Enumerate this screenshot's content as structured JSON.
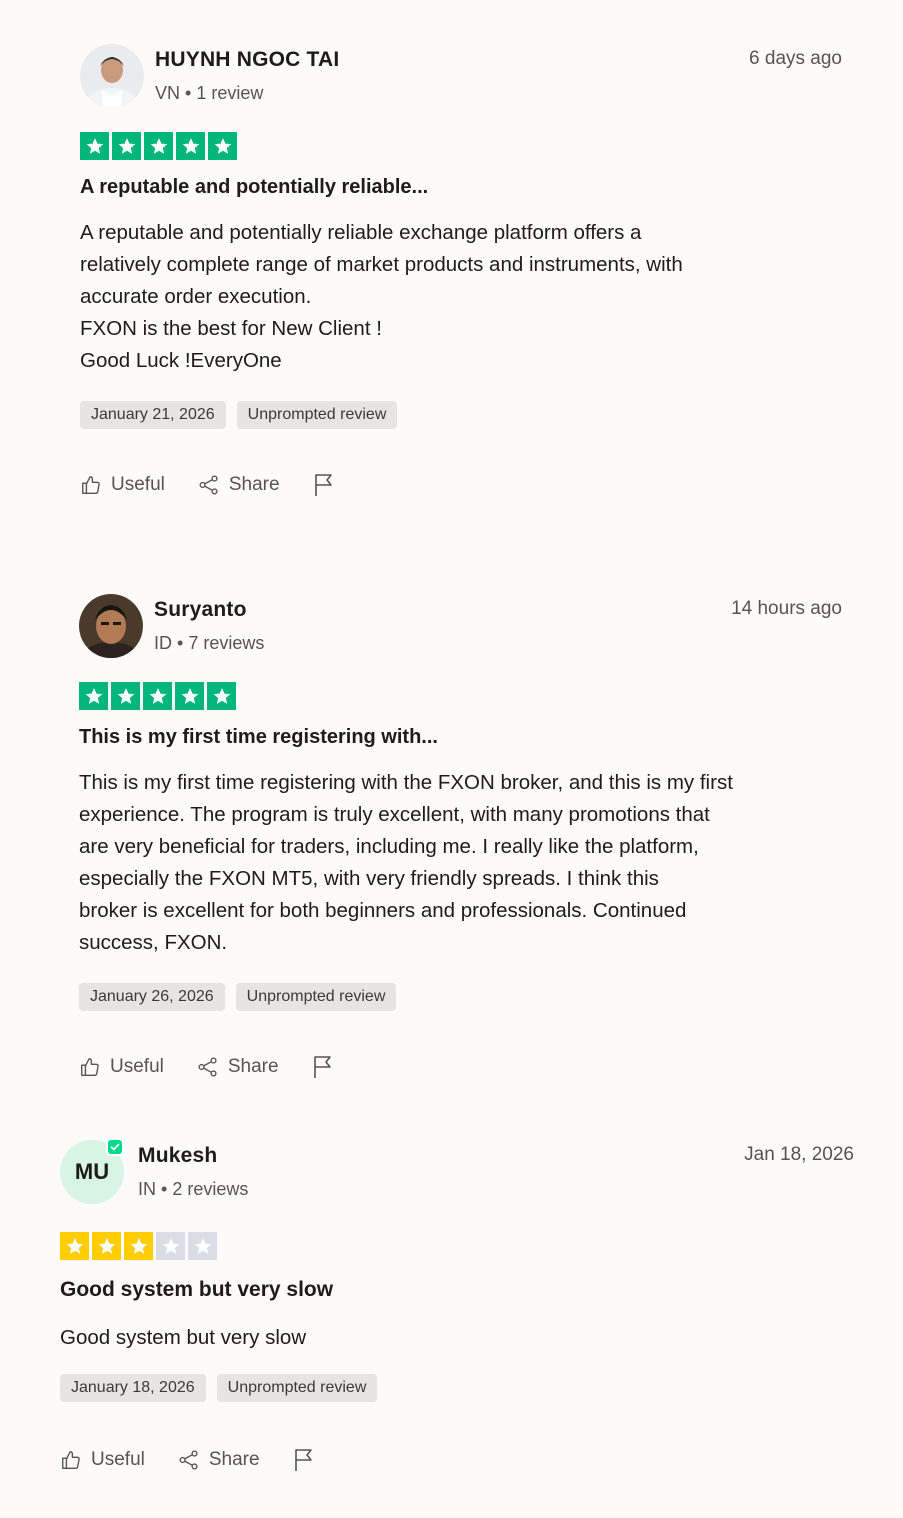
{
  "reviews": [
    {
      "name": "HUYNH NGOC TAI",
      "country": "VN",
      "review_count": "1 review",
      "time_ago": "6 days ago",
      "rating": 5,
      "title": "A reputable and potentially reliable...",
      "body": [
        "A reputable and potentially reliable exchange platform offers a",
        "relatively complete range of market products and instruments, with",
        "accurate order execution.",
        "FXON is the best for New Client !",
        "Good Luck !EveryOne"
      ],
      "experience_date": "January 21, 2026",
      "tag": "Unprompted review"
    },
    {
      "name": "Suryanto",
      "country": "ID",
      "review_count": "7 reviews",
      "time_ago": "14 hours ago",
      "rating": 5,
      "title": "This is my first time registering with...",
      "body": [
        "This is my first time registering with the FXON broker, and this is my first",
        "experience. The program is truly excellent, with many promotions that",
        "are very beneficial for traders, including me. I really like the platform,",
        "especially the FXON MT5, with very friendly spreads. I think this",
        "broker is excellent for both beginners and professionals. Continued",
        "success, FXON."
      ],
      "experience_date": "January 26, 2026",
      "tag": "Unprompted review"
    },
    {
      "name": "Mukesh",
      "initials": "MU",
      "country": "IN",
      "review_count": "2 reviews",
      "time_ago": "Jan 18, 2026",
      "rating": 3,
      "title": "Good system but very slow",
      "body": [
        "Good system but very slow"
      ],
      "experience_date": "January 18, 2026",
      "tag": "Unprompted review"
    }
  ],
  "actions": {
    "useful_label": "Useful",
    "share_label": "Share"
  },
  "colors": {
    "star_green": "#00b67a",
    "star_yellow": "#ffce00",
    "star_empty": "#dcdce6",
    "verified": "#04da8d"
  }
}
